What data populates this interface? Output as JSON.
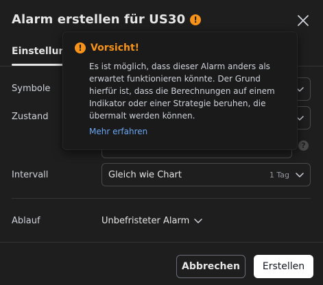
{
  "dialog": {
    "title": "Alarm erstellen für US30",
    "warning_glyph": "!",
    "tab_label": "Einstellungen"
  },
  "form": {
    "symbol_label": "Symbole",
    "condition_label": "Zustand",
    "interval_label": "Intervall",
    "interval_value": "Gleich wie Chart",
    "interval_sub": "1 Tag",
    "expiry_label": "Ablauf",
    "expiry_value": "Unbefristeter Alarm",
    "help_glyph": "?"
  },
  "popover": {
    "title": "Vorsicht!",
    "warning_glyph": "!",
    "body": "Es ist möglich, dass dieser Alarm anders als erwartet funktionieren könnte. Der Grund hierfür ist, dass die Berechnungen auf einem Indikator oder einer Strategie beruhen, die übermalt werden können.",
    "link": "Mehr erfahren"
  },
  "footer": {
    "cancel_label": "Abbrechen",
    "create_label": "Erstellen"
  },
  "colors": {
    "background": "#1e1e1e",
    "warning": "#f7931a",
    "link": "#6ba6f5"
  },
  "icons": [
    "warning-icon",
    "close-icon",
    "chevron-down-icon",
    "help-icon"
  ]
}
